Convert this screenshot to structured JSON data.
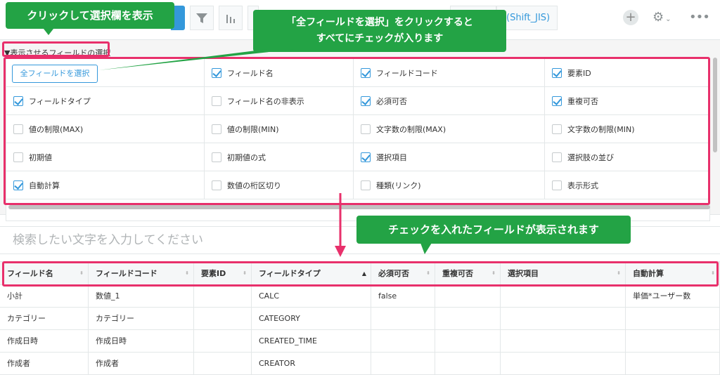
{
  "toolbar": {
    "encoding_label": "(Shift_JIS)",
    "plus_label": "+",
    "gear_label": "⚙",
    "more_label": "•••"
  },
  "selection": {
    "toggle_label": "▼表示させるフィールドの選択",
    "select_all_label": "全フィールドを選択",
    "rows": [
      [
        {
          "label": "",
          "checked": false,
          "type": "button"
        },
        {
          "label": "フィールド名",
          "checked": true
        },
        {
          "label": "フィールドコード",
          "checked": true
        },
        {
          "label": "要素ID",
          "checked": true
        }
      ],
      [
        {
          "label": "フィールドタイプ",
          "checked": true
        },
        {
          "label": "フィールド名の非表示",
          "checked": false
        },
        {
          "label": "必須可否",
          "checked": true
        },
        {
          "label": "重複可否",
          "checked": true
        }
      ],
      [
        {
          "label": "値の制限(MAX)",
          "checked": false
        },
        {
          "label": "値の制限(MIN)",
          "checked": false
        },
        {
          "label": "文字数の制限(MAX)",
          "checked": false
        },
        {
          "label": "文字数の制限(MIN)",
          "checked": false
        }
      ],
      [
        {
          "label": "初期値",
          "checked": false
        },
        {
          "label": "初期値の式",
          "checked": false
        },
        {
          "label": "選択項目",
          "checked": true
        },
        {
          "label": "選択肢の並び",
          "checked": false
        }
      ],
      [
        {
          "label": "自動計算",
          "checked": true
        },
        {
          "label": "数値の桁区切り",
          "checked": false
        },
        {
          "label": "種類(リンク)",
          "checked": false
        },
        {
          "label": "表示形式",
          "checked": false
        }
      ]
    ]
  },
  "search": {
    "placeholder": "検索したい文字を入力してください"
  },
  "table": {
    "headers": [
      "フィールド名",
      "フィールドコード",
      "要素ID",
      "フィールドタイプ",
      "必須可否",
      "重複可否",
      "選択項目",
      "自動計算"
    ],
    "rows": [
      [
        "小計",
        "数値_1",
        "",
        "CALC",
        "false",
        "",
        "",
        "単価*ユーザー数"
      ],
      [
        "カテゴリー",
        "カテゴリー",
        "",
        "CATEGORY",
        "",
        "",
        "",
        ""
      ],
      [
        "作成日時",
        "作成日時",
        "",
        "CREATED_TIME",
        "",
        "",
        "",
        ""
      ],
      [
        "作成者",
        "作成者",
        "",
        "CREATOR",
        "",
        "",
        "",
        ""
      ]
    ]
  },
  "annotations": {
    "callout1": "クリックして選択欄を表示",
    "callout2_line1": "「全フィールドを選択」をクリックすると",
    "callout2_line2": "すべてにチェックが入ります",
    "callout3": "チェックを入れたフィールドが表示されます",
    "highlight_color": "#e8306b",
    "callout_color": "#23a345"
  }
}
